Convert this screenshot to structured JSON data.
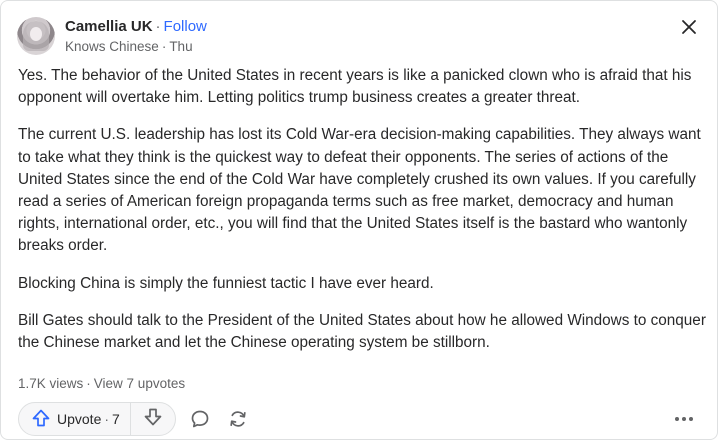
{
  "author": {
    "name": "Camellia UK",
    "follow_label": "Follow",
    "credential": "Knows Chinese",
    "date": "Thu"
  },
  "answer": {
    "paragraphs": [
      "Yes. The behavior of the United States in recent years is like a panicked clown who is afraid that his opponent will overtake him. Letting politics trump business creates a greater threat.",
      "The current U.S. leadership has lost its Cold War-era decision-making capabilities. They always want to take what they think is the quickest way to defeat their opponents. The series of actions of the United States since the end of the Cold War have completely crushed its own values. If you carefully read a series of American foreign propaganda terms such as free market, democracy and human rights, international order, etc., you will find that the United States itself is the bastard who wantonly breaks order.",
      "Blocking China is simply the funniest tactic I have ever heard.",
      "Bill Gates should talk to the President of the United States about how he allowed Windows to conquer the Chinese market and let the Chinese operating system be stillborn."
    ]
  },
  "stats": {
    "views": "1.7K views",
    "upvotes_link": "View 7 upvotes"
  },
  "actions": {
    "upvote_label": "Upvote",
    "upvote_count": "7"
  },
  "colors": {
    "accent": "#2e69ff",
    "text": "#282829",
    "muted": "#636466",
    "border": "#dee0e1"
  },
  "icons": [
    "close-icon",
    "upvote-arrow-icon",
    "downvote-arrow-icon",
    "comment-icon",
    "share-icon",
    "more-options-icon"
  ]
}
